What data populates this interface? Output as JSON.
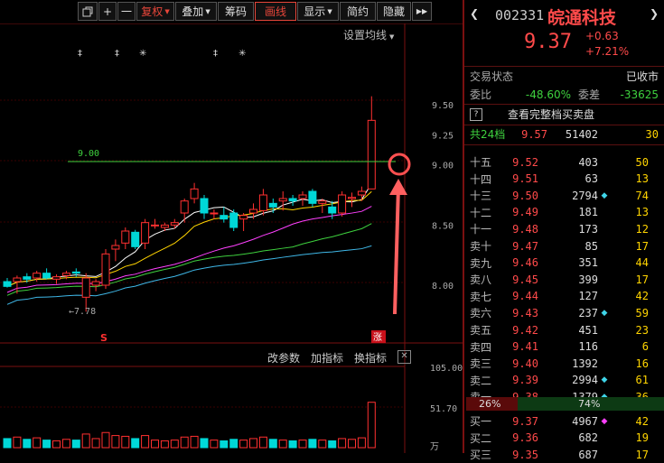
{
  "toolbar": {
    "icon_restore": "window-restore-icon",
    "plus": "+",
    "minus": "一",
    "restore_rights": "复权",
    "overlay": "叠加",
    "chips": "筹码",
    "draw_line": "画线",
    "display": "显示",
    "brief": "简约",
    "hide": "隐藏",
    "more": "▶▶"
  },
  "chart": {
    "settings_ma": "设置均线",
    "price_labels": [
      "9.50",
      "9.25",
      "9.00",
      "8.50",
      "8.00"
    ],
    "line_label": "9.00",
    "low_label": "←7.78",
    "indicator_labels": [
      "改参数",
      "加指标",
      "换指标"
    ],
    "indicator_close": "✕",
    "vol_labels": [
      "105.00",
      "51.70",
      "万"
    ],
    "limit_up_badge": "涨",
    "s_badge": "S",
    "event_marks": [
      "‡",
      "‡",
      "✳",
      "‡",
      "✳"
    ],
    "colors": {
      "up": "#ff3030",
      "down": "#00d8d8",
      "ma5": "#ffffff",
      "ma10": "#ffd400",
      "ma20": "#ff40ff",
      "ma30": "#3ed13e",
      "ma60": "#3fb8e8"
    }
  },
  "chart_data": {
    "type": "candlestick",
    "ylim": [
      7.7,
      9.65
    ],
    "candles": [
      {
        "o": 8.03,
        "h": 8.06,
        "l": 7.98,
        "c": 7.99
      },
      {
        "o": 8.03,
        "h": 8.08,
        "l": 7.93,
        "c": 8.06
      },
      {
        "o": 8.07,
        "h": 8.1,
        "l": 8.02,
        "c": 8.05
      },
      {
        "o": 8.06,
        "h": 8.12,
        "l": 8.03,
        "c": 8.1
      },
      {
        "o": 8.1,
        "h": 8.14,
        "l": 8.05,
        "c": 8.06
      },
      {
        "o": 8.05,
        "h": 8.09,
        "l": 8.01,
        "c": 8.07
      },
      {
        "o": 8.08,
        "h": 8.12,
        "l": 8.05,
        "c": 8.1
      },
      {
        "o": 8.11,
        "h": 8.14,
        "l": 8.07,
        "c": 8.1
      },
      {
        "o": 7.9,
        "h": 8.1,
        "l": 7.78,
        "c": 8.06
      },
      {
        "o": 8.0,
        "h": 8.05,
        "l": 7.95,
        "c": 8.03
      },
      {
        "o": 8.0,
        "h": 8.3,
        "l": 7.97,
        "c": 8.26
      },
      {
        "o": 8.3,
        "h": 8.38,
        "l": 8.2,
        "c": 8.33
      },
      {
        "o": 8.35,
        "h": 8.48,
        "l": 8.3,
        "c": 8.45
      },
      {
        "o": 8.44,
        "h": 8.46,
        "l": 8.3,
        "c": 8.32
      },
      {
        "o": 8.35,
        "h": 8.55,
        "l": 8.3,
        "c": 8.52
      },
      {
        "o": 8.5,
        "h": 8.55,
        "l": 8.47,
        "c": 8.5
      },
      {
        "o": 8.48,
        "h": 8.52,
        "l": 8.45,
        "c": 8.5
      },
      {
        "o": 8.5,
        "h": 8.55,
        "l": 8.47,
        "c": 8.52
      },
      {
        "o": 8.6,
        "h": 8.72,
        "l": 8.52,
        "c": 8.7
      },
      {
        "o": 8.72,
        "h": 8.85,
        "l": 8.68,
        "c": 8.8
      },
      {
        "o": 8.72,
        "h": 8.75,
        "l": 8.55,
        "c": 8.6
      },
      {
        "o": 8.6,
        "h": 8.63,
        "l": 8.55,
        "c": 8.6
      },
      {
        "o": 8.58,
        "h": 8.65,
        "l": 8.52,
        "c": 8.55
      },
      {
        "o": 8.6,
        "h": 8.63,
        "l": 8.45,
        "c": 8.48
      },
      {
        "o": 8.55,
        "h": 8.6,
        "l": 8.45,
        "c": 8.58
      },
      {
        "o": 8.6,
        "h": 8.68,
        "l": 8.55,
        "c": 8.63
      },
      {
        "o": 8.62,
        "h": 8.8,
        "l": 8.58,
        "c": 8.75
      },
      {
        "o": 8.68,
        "h": 8.72,
        "l": 8.6,
        "c": 8.65
      },
      {
        "o": 8.7,
        "h": 8.78,
        "l": 8.62,
        "c": 8.72
      },
      {
        "o": 8.72,
        "h": 8.75,
        "l": 8.66,
        "c": 8.7
      },
      {
        "o": 8.72,
        "h": 8.78,
        "l": 8.66,
        "c": 8.75
      },
      {
        "o": 8.78,
        "h": 8.8,
        "l": 8.65,
        "c": 8.68
      },
      {
        "o": 8.68,
        "h": 8.72,
        "l": 8.6,
        "c": 8.7
      },
      {
        "o": 8.65,
        "h": 8.7,
        "l": 8.55,
        "c": 8.6
      },
      {
        "o": 8.6,
        "h": 8.78,
        "l": 8.57,
        "c": 8.75
      },
      {
        "o": 8.72,
        "h": 8.77,
        "l": 8.65,
        "c": 8.73
      },
      {
        "o": 8.75,
        "h": 8.82,
        "l": 8.7,
        "c": 8.78
      },
      {
        "o": 8.8,
        "h": 9.57,
        "l": 8.8,
        "c": 9.37
      }
    ],
    "volume": [
      12,
      14,
      11,
      13,
      10,
      9,
      11,
      10,
      18,
      12,
      20,
      16,
      15,
      12,
      16,
      10,
      9,
      10,
      14,
      15,
      12,
      10,
      9,
      11,
      10,
      12,
      14,
      11,
      10,
      9,
      10,
      11,
      10,
      9,
      12,
      11,
      13,
      60
    ],
    "vol_ylim": [
      0,
      105
    ]
  },
  "stock": {
    "code": "002331",
    "name": "皖通科技",
    "price": "9.37",
    "change": "+0.63",
    "change_pct": "+7.21%"
  },
  "status": {
    "label": "交易状态",
    "value": "已收市"
  },
  "ratio": {
    "label1": "委比",
    "value1": "-48.60%",
    "label2": "委差",
    "value2": "-33625"
  },
  "full_book": {
    "icon": "?",
    "label": "查看完整档买卖盘"
  },
  "total": {
    "label": "共24档",
    "price": "9.57",
    "vol": "51402",
    "count": "30"
  },
  "asks": [
    {
      "name": "十五",
      "price": "9.52",
      "vol": "403",
      "mark": "",
      "count": "50"
    },
    {
      "name": "十四",
      "price": "9.51",
      "vol": "63",
      "mark": "",
      "count": "13"
    },
    {
      "name": "十三",
      "price": "9.50",
      "vol": "2794",
      "mark": "◆",
      "count": "74"
    },
    {
      "name": "十二",
      "price": "9.49",
      "vol": "181",
      "mark": "",
      "count": "13"
    },
    {
      "name": "十一",
      "price": "9.48",
      "vol": "173",
      "mark": "",
      "count": "12"
    },
    {
      "name": "卖十",
      "price": "9.47",
      "vol": "85",
      "mark": "",
      "count": "17"
    },
    {
      "name": "卖九",
      "price": "9.46",
      "vol": "351",
      "mark": "",
      "count": "44"
    },
    {
      "name": "卖八",
      "price": "9.45",
      "vol": "399",
      "mark": "",
      "count": "17"
    },
    {
      "name": "卖七",
      "price": "9.44",
      "vol": "127",
      "mark": "",
      "count": "42"
    },
    {
      "name": "卖六",
      "price": "9.43",
      "vol": "237",
      "mark": "◆",
      "count": "59"
    },
    {
      "name": "卖五",
      "price": "9.42",
      "vol": "451",
      "mark": "",
      "count": "23"
    },
    {
      "name": "卖四",
      "price": "9.41",
      "vol": "116",
      "mark": "",
      "count": "6"
    },
    {
      "name": "卖三",
      "price": "9.40",
      "vol": "1392",
      "mark": "",
      "count": "16"
    },
    {
      "name": "卖二",
      "price": "9.39",
      "vol": "2994",
      "mark": "◆",
      "count": "61"
    },
    {
      "name": "卖一",
      "price": "9.38",
      "vol": "1379",
      "mark": "◆",
      "count": "36"
    }
  ],
  "split": {
    "buy_pct": "26%",
    "sell_pct": "74%",
    "buy_frac": 0.26
  },
  "bids": [
    {
      "name": "买一",
      "price": "9.37",
      "vol": "4967",
      "mark": "◆",
      "count": "42"
    },
    {
      "name": "买二",
      "price": "9.36",
      "vol": "682",
      "mark": "",
      "count": "19"
    },
    {
      "name": "买三",
      "price": "9.35",
      "vol": "687",
      "mark": "",
      "count": "17"
    }
  ]
}
